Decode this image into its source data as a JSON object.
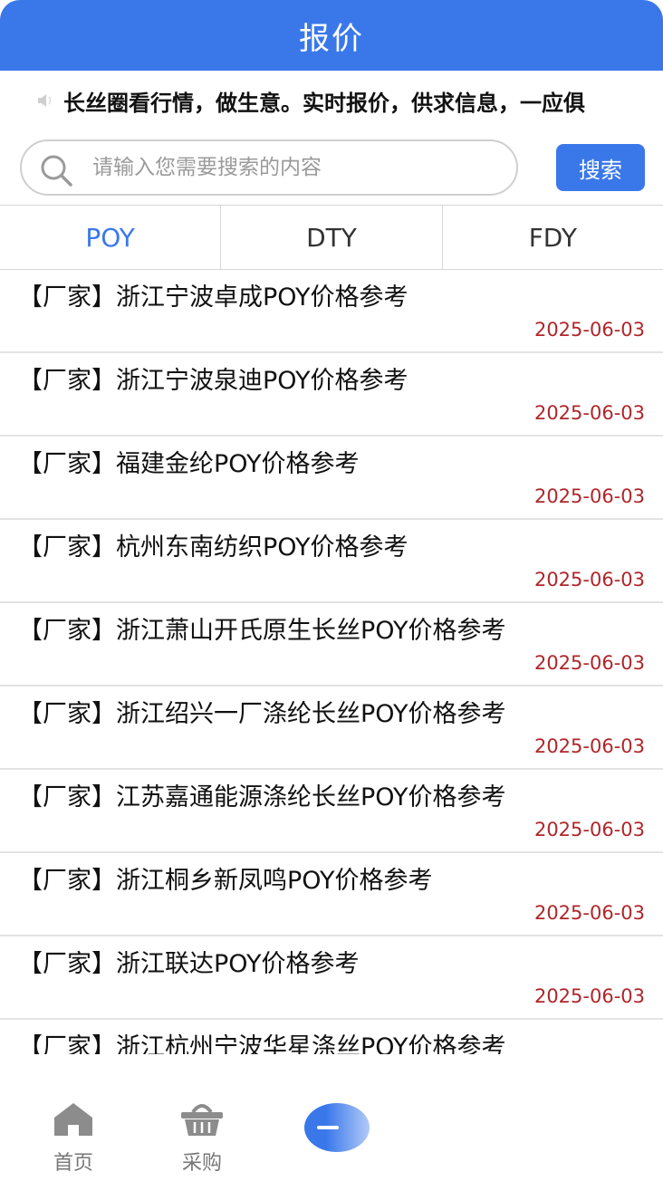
{
  "header": {
    "title": "报价"
  },
  "marquee": {
    "text": "长丝圈看行情，做生意。实时报价，供求信息，一应俱"
  },
  "search": {
    "placeholder": "请输入您需要搜索的内容",
    "button_label": "搜索"
  },
  "tabs": [
    {
      "label": "POY",
      "active": true
    },
    {
      "label": "DTY",
      "active": false
    },
    {
      "label": "FDY",
      "active": false
    }
  ],
  "list": [
    {
      "title": "【厂家】浙江宁波卓成POY价格参考",
      "date": "2025-06-03"
    },
    {
      "title": "【厂家】浙江宁波泉迪POY价格参考",
      "date": "2025-06-03"
    },
    {
      "title": "【厂家】福建金纶POY价格参考",
      "date": "2025-06-03"
    },
    {
      "title": "【厂家】杭州东南纺织POY价格参考",
      "date": "2025-06-03"
    },
    {
      "title": "【厂家】浙江萧山开氏原生长丝POY价格参考",
      "date": "2025-06-03"
    },
    {
      "title": "【厂家】浙江绍兴一厂涤纶长丝POY价格参考",
      "date": "2025-06-03"
    },
    {
      "title": "【厂家】江苏嘉通能源涤纶长丝POY价格参考",
      "date": "2025-06-03"
    },
    {
      "title": "【厂家】浙江桐乡新凤鸣POY价格参考",
      "date": "2025-06-03"
    },
    {
      "title": "【厂家】浙江联达POY价格参考",
      "date": "2025-06-03"
    },
    {
      "title": "【厂家】浙江杭州宁波华星涤丝POY价格参考",
      "date": ""
    }
  ],
  "bottom_nav": [
    {
      "label": "首页",
      "icon": "home-icon"
    },
    {
      "label": "采购",
      "icon": "basket-icon"
    }
  ],
  "colors": {
    "primary": "#3a78ea",
    "date": "#b0262a"
  }
}
